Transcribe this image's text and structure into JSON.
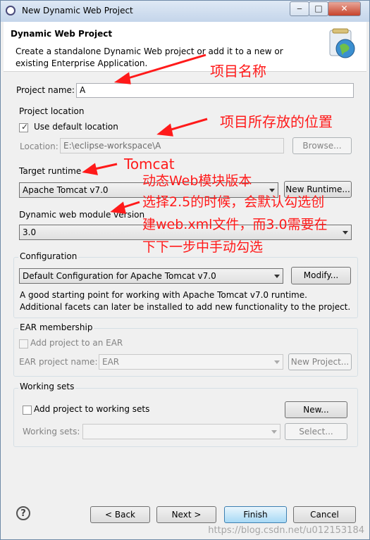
{
  "window": {
    "title": "New Dynamic Web Project",
    "min_label": "‒",
    "max_label": "□",
    "close_label": "✕"
  },
  "header": {
    "title": "Dynamic Web Project",
    "description": "Create a standalone Dynamic Web project or add it to a new or existing Enterprise Application."
  },
  "project_name": {
    "label": "Project name:",
    "value": "A"
  },
  "project_location": {
    "title": "Project location",
    "use_default_label": "Use default location",
    "use_default_checked": true,
    "location_label": "Location:",
    "location_value": "E:\\eclipse-workspace\\A",
    "browse_label": "Browse..."
  },
  "target_runtime": {
    "title": "Target runtime",
    "value": "Apache Tomcat v7.0",
    "new_runtime_label": "New Runtime..."
  },
  "module_version": {
    "title": "Dynamic web module version",
    "value": "3.0"
  },
  "configuration": {
    "title": "Configuration",
    "value": "Default Configuration for Apache Tomcat v7.0",
    "modify_label": "Modify...",
    "description": "A good starting point for working with Apache Tomcat v7.0 runtime. Additional facets can later be installed to add new functionality to the project."
  },
  "ear": {
    "title": "EAR membership",
    "add_label": "Add project to an EAR",
    "project_name_label": "EAR project name:",
    "project_name_value": "EAR",
    "new_project_label": "New Project..."
  },
  "working_sets": {
    "title": "Working sets",
    "add_label": "Add project to working sets",
    "new_label": "New...",
    "sets_label": "Working sets:",
    "select_label": "Select..."
  },
  "footer": {
    "help_label": "?",
    "back_label": "< Back",
    "next_label": "Next >",
    "finish_label": "Finish",
    "cancel_label": "Cancel"
  },
  "annotations": {
    "project_name": "项目名称",
    "location": "项目所存放的位置",
    "tomcat": "Tomcat",
    "module_line1": "动态Web模块版本",
    "module_line2": "选择2.5的时候，会默认勾选创",
    "module_line3": "建web.xml文件，而3.0需要在",
    "module_line4": "下下一步中手动勾选"
  },
  "watermark": "https://blog.csdn.net/u012153184",
  "colors": {
    "annotation": "#ff1a1a",
    "accent": "#3c7fb1"
  }
}
